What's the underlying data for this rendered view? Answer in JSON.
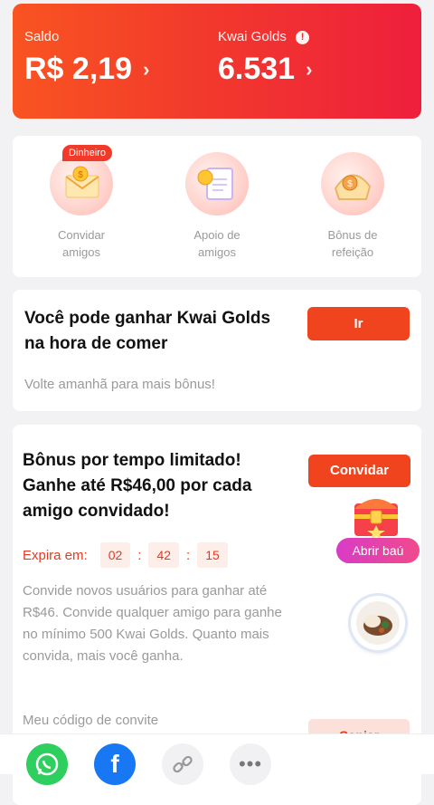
{
  "header": {
    "saldo_label": "Saldo",
    "saldo_value": "R$ 2,19",
    "golds_label": "Kwai Golds",
    "golds_value": "6.531",
    "accent": "#ee2b35"
  },
  "icons": [
    {
      "label_line1": "Convidar",
      "label_line2": "amigos",
      "badge": "Dinheiro",
      "icon": "envelope-coin-icon"
    },
    {
      "label_line1": "Apoio de",
      "label_line2": "amigos",
      "icon": "clipboard-coin-icon"
    },
    {
      "label_line1": "Bônus de",
      "label_line2": "refeição",
      "icon": "bread-coin-icon"
    }
  ],
  "eat_card": {
    "title_line1": "Você pode ganhar Kwai Golds",
    "title_line2": "na hora de comer",
    "button": "Ir",
    "subtitle": "Volte amanhã para mais bônus!"
  },
  "bonus_card": {
    "title_line1": "Bônus por tempo limitado!",
    "title_line2": "Ganhe até R$46,00 por cada",
    "title_line3": "amigo convidado!",
    "button": "Convidar",
    "expira_label": "Expira em:",
    "timer": {
      "h": "02",
      "m": "42",
      "s": "15"
    },
    "description": "Convide novos usuários para ganhar até R$46. Convide qualquer amigo para ganhe no mínimo 500 Kwai Golds. Quanto mais convida, mais você ganha.",
    "code_label": "Meu código de convite",
    "copy_button": "Copiar"
  },
  "floating": {
    "chest_label": "Abrir baú"
  },
  "share_bar": {
    "items": [
      "whatsapp-icon",
      "facebook-icon",
      "link-icon",
      "more-icon"
    ]
  }
}
